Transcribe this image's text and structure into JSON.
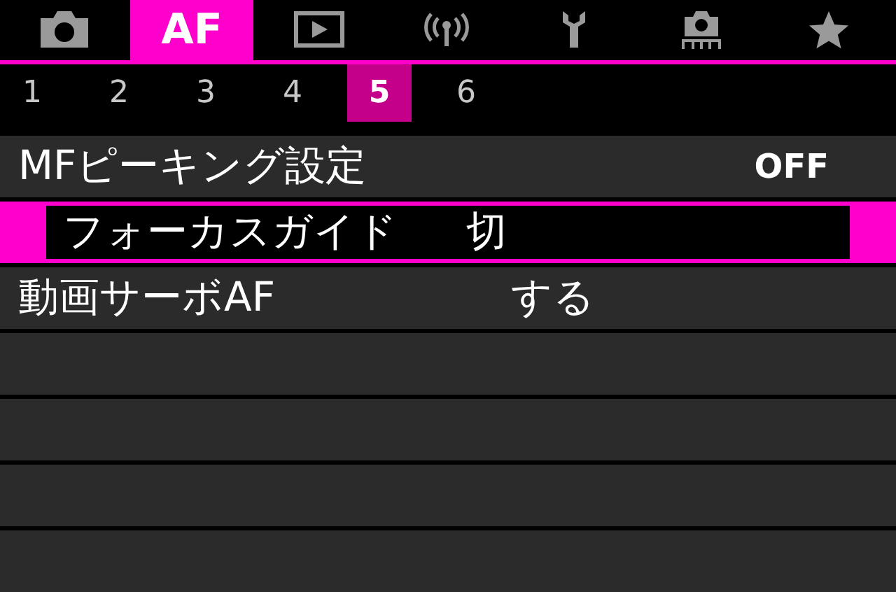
{
  "tabs": [
    {
      "kind": "camera",
      "selected": false
    },
    {
      "kind": "text",
      "label": "AF",
      "selected": true
    },
    {
      "kind": "play",
      "selected": false
    },
    {
      "kind": "wireless",
      "selected": false
    },
    {
      "kind": "wrench",
      "selected": false
    },
    {
      "kind": "custom",
      "selected": false
    },
    {
      "kind": "star",
      "selected": false
    }
  ],
  "pages": [
    {
      "label": "1",
      "selected": false
    },
    {
      "label": "2",
      "selected": false
    },
    {
      "label": "3",
      "selected": false
    },
    {
      "label": "4",
      "selected": false
    },
    {
      "label": "5",
      "selected": true
    },
    {
      "label": "6",
      "selected": false
    }
  ],
  "menu_items": [
    {
      "label": "MFピーキング設定",
      "value": "OFF",
      "kind": "right",
      "selected": false
    },
    {
      "label": "フォーカスガイド",
      "value": "切",
      "kind": "column",
      "selected": true
    },
    {
      "label": "動画サーボAF",
      "value": "する",
      "kind": "column",
      "selected": false
    }
  ]
}
